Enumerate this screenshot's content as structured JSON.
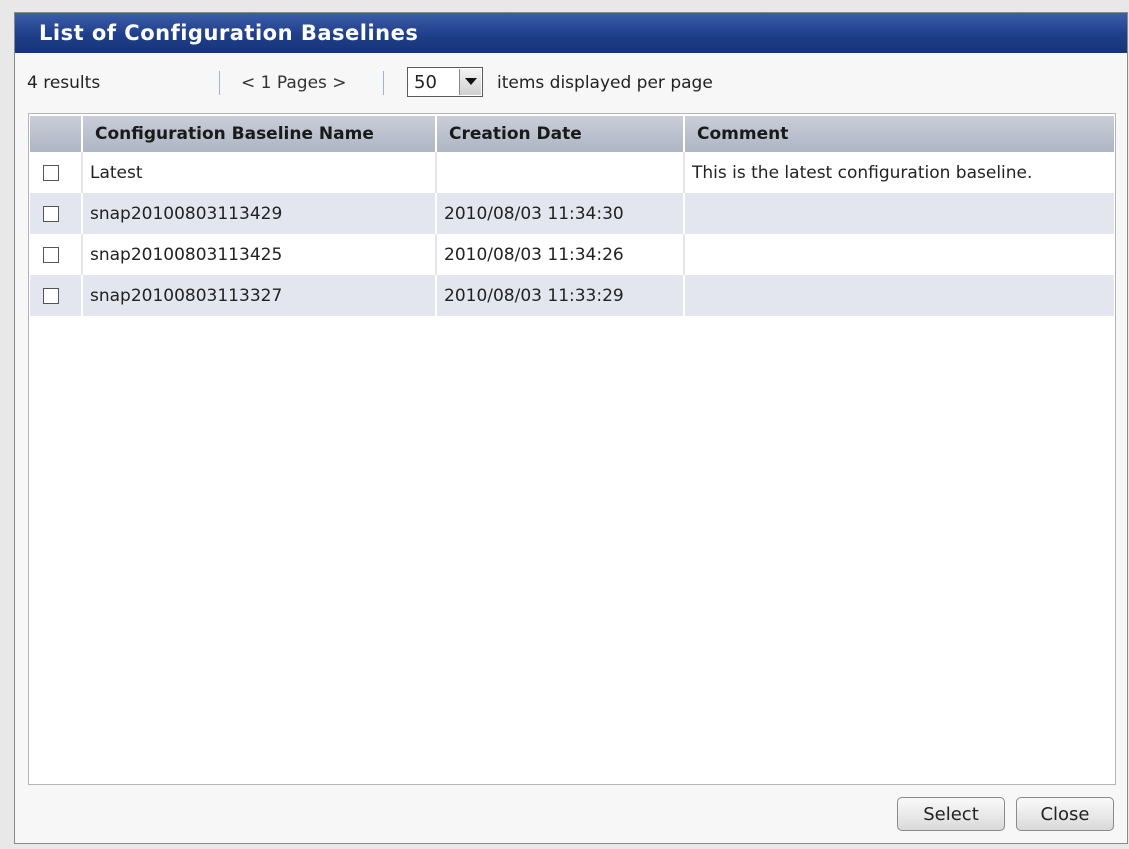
{
  "dialog": {
    "title": "List of Configuration Baselines"
  },
  "toolbar": {
    "results": "4 results",
    "pages": "< 1 Pages >",
    "page_size": "50",
    "per_page_label": "items displayed per page"
  },
  "table": {
    "headers": [
      "",
      "Configuration Baseline Name",
      "Creation Date",
      "Comment"
    ],
    "rows": [
      {
        "name": "Latest",
        "date": "",
        "comment": "This is the latest configuration baseline."
      },
      {
        "name": "snap20100803113429",
        "date": "2010/08/03 11:34:30",
        "comment": ""
      },
      {
        "name": "snap20100803113425",
        "date": "2010/08/03 11:34:26",
        "comment": ""
      },
      {
        "name": "snap20100803113327",
        "date": "2010/08/03 11:33:29",
        "comment": ""
      }
    ]
  },
  "buttons": {
    "select": "Select",
    "close": "Close"
  },
  "colors": {
    "titlebar": "#1f3f8c",
    "header": "#b8bfcc",
    "row_alt": "#e3e6ee"
  }
}
